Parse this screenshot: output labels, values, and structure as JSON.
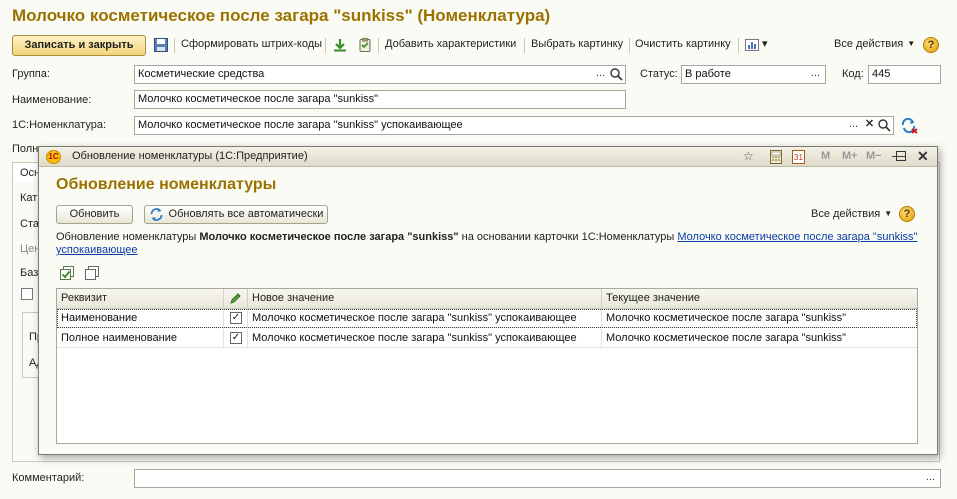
{
  "window": {
    "title": "Молочко косметическое после загара \"sunkiss\" (Номенклатура)"
  },
  "toolbar": {
    "save_close": "Записать и закрыть",
    "barcodes": "Сформировать штрих-коды",
    "add_characteristics": "Добавить характеристики",
    "choose_picture": "Выбрать картинку",
    "clear_picture": "Очистить картинку",
    "all_actions": "Все действия",
    "help": "?"
  },
  "form": {
    "group_label": "Группа:",
    "group_value": "Косметические средства",
    "status_label": "Статус:",
    "status_value": "В работе",
    "code_label": "Код:",
    "code_value": "445",
    "name_label": "Наименование:",
    "name_value": "Молочко косметическое после загара \"sunkiss\"",
    "onec_label": "1С:Номенклатура:",
    "onec_value": "Молочко косметическое после загара \"sunkiss\" успокаивающее",
    "full_label_fragment": "Полн",
    "comment_label": "Комментарий:",
    "comment_value": "",
    "ellipsis": "...",
    "clear": "✕",
    "search": "🔍"
  },
  "obscured": {
    "tab_fragment": "Осн",
    "kat": "Кат",
    "sta": "Ста",
    "cen": "Цен",
    "baz": "Баз",
    "pr": "Пр",
    "ad": "Ад"
  },
  "dialog": {
    "title": "Обновление номенклатуры  (1С:Предприятие)",
    "heading": "Обновление номенклатуры",
    "btn_update": "Обновить",
    "btn_auto_update": "Обновлять все автоматически",
    "all_actions": "Все действия",
    "help": "?",
    "info_prefix": "Обновление номенклатуры ",
    "info_item": "Молочко косметическое после загара \"sunkiss\"",
    "info_middle": "  на основании карточки 1С:Номенклатуры ",
    "info_link": "Молочко косметическое после загара \"sunkiss\" успокаивающее",
    "title_icons": {
      "m": "M",
      "m_plus": "M+",
      "m_minus": "M−",
      "calendar": "31"
    },
    "grid": {
      "columns": [
        "Реквизит",
        "",
        "Новое значение",
        "Текущее значение"
      ],
      "rows": [
        {
          "attribute": "Наименование",
          "checked": "✓",
          "new_value": "Молочко косметическое после загара \"sunkiss\" успокаивающее",
          "current_value": "Молочко косметическое после загара \"sunkiss\""
        },
        {
          "attribute": "Полное наименование",
          "checked": "✓",
          "new_value": "Молочко косметическое после загара \"sunkiss\" успокаивающее",
          "current_value": "Молочко косметическое после загара \"sunkiss\""
        }
      ]
    }
  },
  "colors": {
    "title_gold": "#9a7200",
    "link_blue": "#0b3ba5",
    "primary_button": "#f3d47a"
  }
}
